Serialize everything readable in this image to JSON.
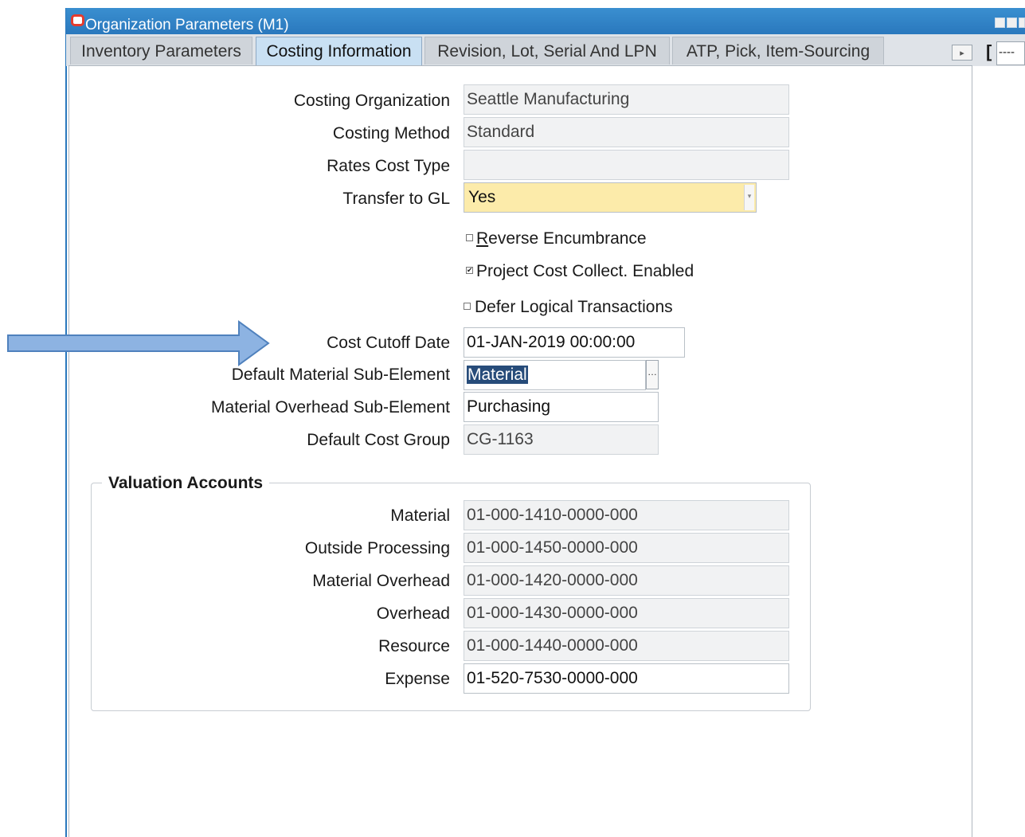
{
  "window": {
    "title": "Organization Parameters (M1)"
  },
  "tabs": [
    {
      "label": "Inventory Parameters"
    },
    {
      "label": "Costing Information"
    },
    {
      "label": "Revision, Lot, Serial And LPN"
    },
    {
      "label": "ATP, Pick, Item-Sourcing"
    }
  ],
  "side": {
    "bracket": "[",
    "box_value": "----"
  },
  "form": {
    "costing_organization": {
      "label": "Costing Organization",
      "value": "Seattle Manufacturing"
    },
    "costing_method": {
      "label": "Costing Method",
      "value": "Standard"
    },
    "rates_cost_type": {
      "label": "Rates Cost Type",
      "value": ""
    },
    "transfer_to_gl": {
      "label": "Transfer to GL",
      "value": "Yes"
    },
    "reverse_encumbrance": {
      "label_first": "R",
      "label_rest": "everse Encumbrance",
      "checked": false
    },
    "project_cost_collect": {
      "label": "Project Cost Collect. Enabled",
      "checked": true
    },
    "defer_logical": {
      "label": "Defer Logical Transactions",
      "checked": false
    },
    "cost_cutoff_date": {
      "label": "Cost Cutoff Date",
      "value": "01-JAN-2019 00:00:00"
    },
    "default_material_sub_element": {
      "label": "Default Material Sub-Element",
      "value": "Material"
    },
    "material_overhead_sub_element": {
      "label": "Material Overhead Sub-Element",
      "value": "Purchasing"
    },
    "default_cost_group": {
      "label": "Default Cost Group",
      "value": "CG-1163"
    }
  },
  "valuation": {
    "title": "Valuation Accounts",
    "material": {
      "label": "Material",
      "value": "01-000-1410-0000-000"
    },
    "outside_processing": {
      "label": "Outside Processing",
      "value": "01-000-1450-0000-000"
    },
    "material_overhead": {
      "label": "Material Overhead",
      "value": "01-000-1420-0000-000"
    },
    "overhead": {
      "label": "Overhead",
      "value": "01-000-1430-0000-000"
    },
    "resource": {
      "label": "Resource",
      "value": "01-000-1440-0000-000"
    },
    "expense": {
      "label": "Expense",
      "value": "01-520-7530-0000-000"
    }
  },
  "colors": {
    "titlebar": "#2a78bd",
    "active_tab": "#c9e0f3",
    "required_field": "#fcebaa",
    "arrow": "#8db3e2",
    "selection": "#274c7a"
  }
}
